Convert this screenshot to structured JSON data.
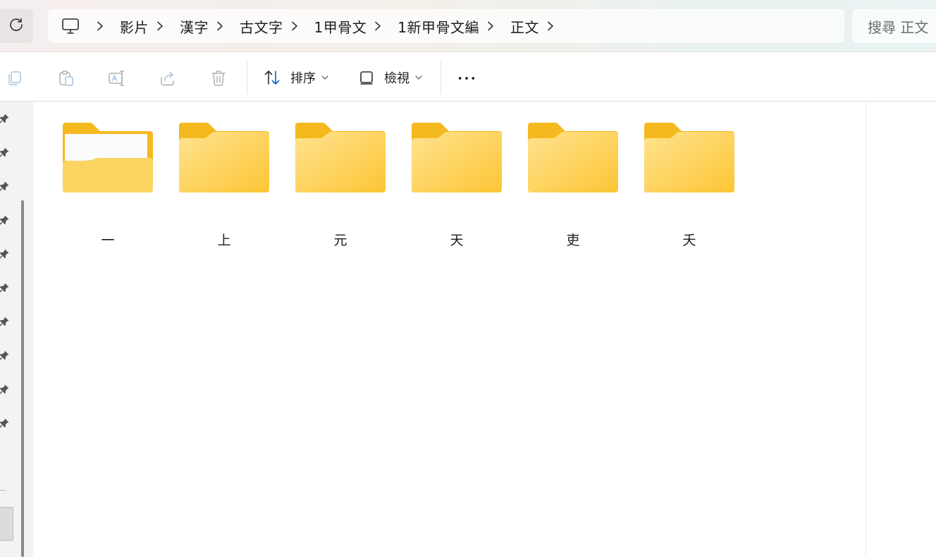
{
  "address_bar": {
    "refresh_icon": "refresh-icon",
    "pc_icon": "this-pc-icon",
    "breadcrumbs": [
      "影片",
      "漢字",
      "古文字",
      "1甲骨文",
      "1新甲骨文編",
      "正文"
    ],
    "search_placeholder": "搜尋 正文"
  },
  "command_bar": {
    "icons": [
      "copy-icon",
      "paste-icon",
      "rename-icon",
      "share-icon",
      "delete-icon"
    ],
    "sort_label": "排序",
    "view_label": "檢視",
    "more_icon": "more-options-icon"
  },
  "navigation": {
    "pinned_count": 10
  },
  "folders": [
    {
      "name": "一",
      "has_preview": true
    },
    {
      "name": "上",
      "has_preview": false
    },
    {
      "name": "元",
      "has_preview": false
    },
    {
      "name": "天",
      "has_preview": false
    },
    {
      "name": "吏",
      "has_preview": false
    },
    {
      "name": "夭",
      "has_preview": false
    }
  ],
  "colors": {
    "folder_back": "#f4b91e",
    "folder_front_light": "#ffe18d",
    "folder_front_dark": "#fcc63b",
    "accent": "#0a64c8"
  }
}
